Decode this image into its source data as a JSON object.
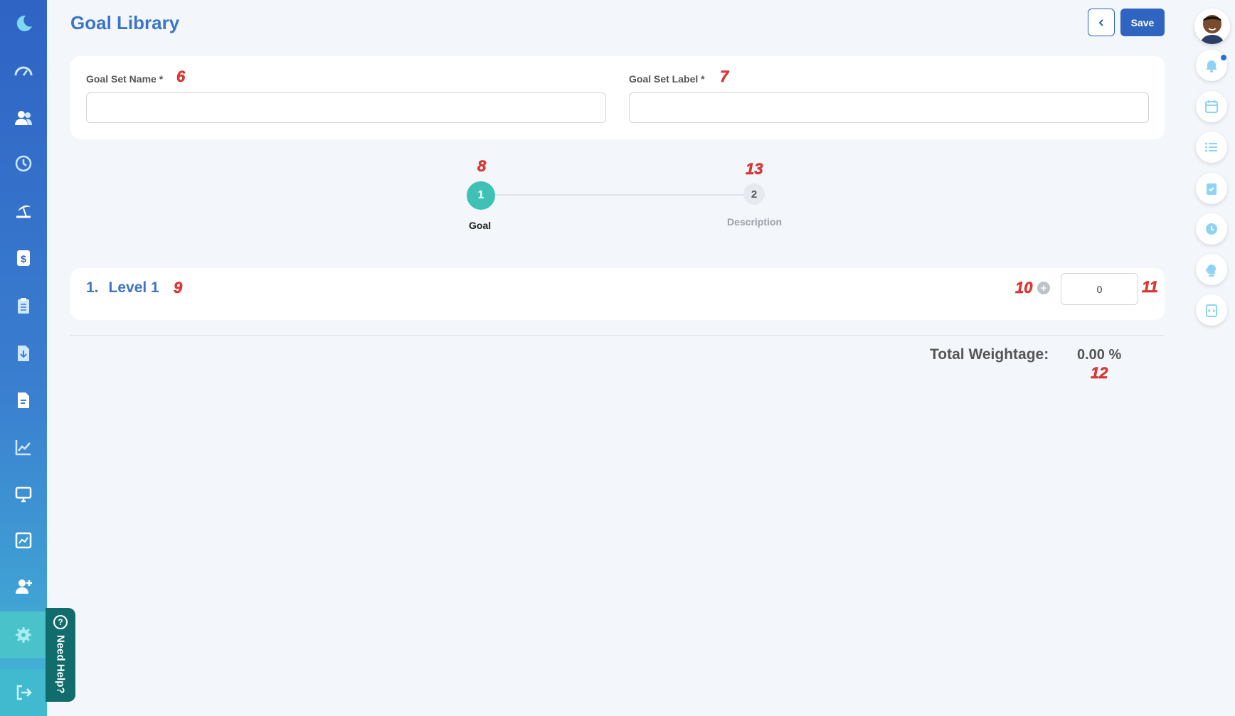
{
  "header": {
    "title": "Goal Library",
    "save_label": "Save"
  },
  "sidebar": {
    "items": [
      {
        "icon": "moon-logo-icon"
      },
      {
        "icon": "dashboard-gauge-icon"
      },
      {
        "icon": "people-icon"
      },
      {
        "icon": "history-icon"
      },
      {
        "icon": "leave-beach-icon"
      },
      {
        "icon": "payroll-dollar-icon"
      },
      {
        "icon": "clipboard-icon"
      },
      {
        "icon": "document-download-icon"
      },
      {
        "icon": "document-text-icon"
      },
      {
        "icon": "line-chart-icon"
      },
      {
        "icon": "monitor-icon"
      },
      {
        "icon": "report-chart-icon"
      },
      {
        "icon": "add-user-icon"
      },
      {
        "icon": "settings-gear-icon"
      },
      {
        "icon": "logout-icon"
      }
    ],
    "need_help": "Need Help?"
  },
  "form": {
    "goal_set_name_label": "Goal Set Name *",
    "goal_set_name_value": "",
    "goal_set_label_label": "Goal Set Label *",
    "goal_set_label_value": ""
  },
  "stepper": {
    "steps": [
      {
        "number": "1",
        "label": "Goal",
        "active": true
      },
      {
        "number": "2",
        "label": "Description",
        "active": false
      }
    ]
  },
  "level": {
    "number": "1.",
    "title": "Level 1",
    "weight_value": "0"
  },
  "totals": {
    "label": "Total Weightage:",
    "value": "0.00 %"
  },
  "annotations": [
    "6",
    "7",
    "8",
    "13",
    "9",
    "10",
    "11",
    "12"
  ],
  "colors": {
    "primary": "#3d74c6",
    "save_button": "#2f65c0",
    "step_active": "#3fc1b5",
    "marker": "#e53935",
    "help_tab": "#116d6b"
  }
}
